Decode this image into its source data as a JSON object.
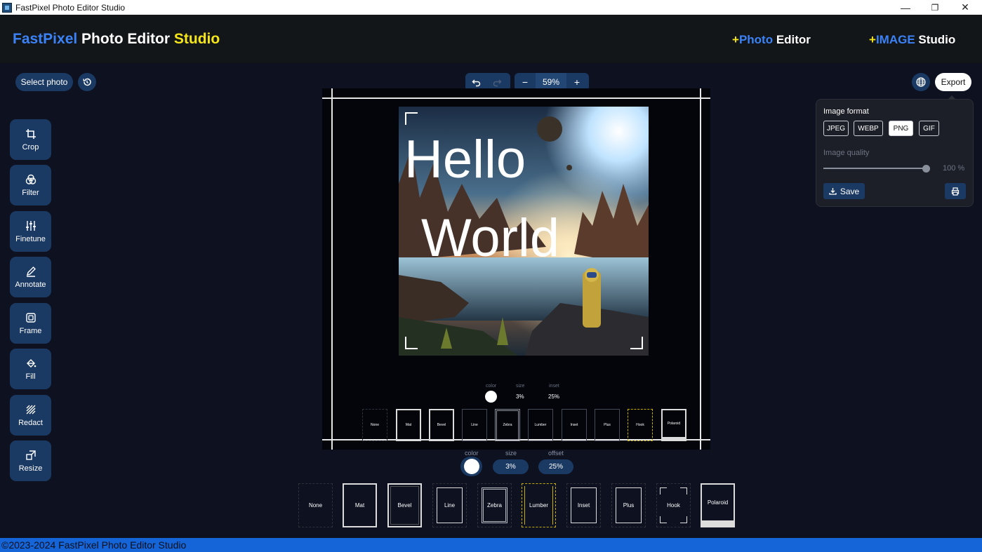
{
  "window": {
    "title": "FastPixel Photo Editor Studio",
    "minimize_glyph": "—",
    "restore_glyph": "❐",
    "close_glyph": "✕"
  },
  "header": {
    "brand_part1": "FastPixel",
    "brand_part2": " Photo Editor ",
    "brand_part3": "Studio",
    "link1_plus": "+",
    "link1_accent": "Photo",
    "link1_rest": " Editor",
    "link2_plus": "+",
    "link2_accent": "IMAGE",
    "link2_rest": " Studio"
  },
  "toolbar": {
    "select_photo": "Select photo",
    "history_icon": "history-icon",
    "zoom_out": "−",
    "zoom_value": "59%",
    "zoom_in": "+",
    "language_icon": "globe-icon",
    "export": "Export"
  },
  "sidebar": {
    "items": [
      {
        "label": "Crop",
        "icon": "crop-icon"
      },
      {
        "label": "Filter",
        "icon": "filter-icon"
      },
      {
        "label": "Finetune",
        "icon": "sliders-icon"
      },
      {
        "label": "Annotate",
        "icon": "pencil-icon"
      },
      {
        "label": "Frame",
        "icon": "frame-icon"
      },
      {
        "label": "Fill",
        "icon": "fill-icon"
      },
      {
        "label": "Redact",
        "icon": "redact-icon"
      },
      {
        "label": "Resize",
        "icon": "resize-icon"
      }
    ]
  },
  "canvas": {
    "text_line1": "Hello",
    "text_line2": "World",
    "mini_options": {
      "color_label": "color",
      "size_label": "size",
      "size_value": "3%",
      "inset_label": "inset",
      "inset_value": "25%"
    },
    "mini_frames": [
      "None",
      "Mat",
      "Bevel",
      "Line",
      "Zebra",
      "Lumber",
      "Inset",
      "Plus",
      "Hook",
      "Polaroid"
    ]
  },
  "frame_options": {
    "color_label": "color",
    "size_label": "size",
    "size_value": "3%",
    "offset_label": "offset",
    "offset_value": "25%",
    "frames": [
      "None",
      "Mat",
      "Bevel",
      "Line",
      "Zebra",
      "Lumber",
      "Inset",
      "Plus",
      "Hook",
      "Polaroid"
    ],
    "selected": "Lumber"
  },
  "export_panel": {
    "format_label": "Image format",
    "formats": [
      "JPEG",
      "WEBP",
      "PNG",
      "GIF"
    ],
    "selected_format": "PNG",
    "quality_label": "Image quality",
    "quality_value": "100 %",
    "quality_level": 100,
    "save": "Save",
    "print_icon": "printer-icon"
  },
  "footer": {
    "copyright": "©2023-2024 FastPixel Photo Editor Studio"
  },
  "colors": {
    "accent_blue": "#3b82f6",
    "accent_yellow": "#f5e61a",
    "button_bg": "#1b3a63",
    "footer_bg": "#1565d8"
  }
}
